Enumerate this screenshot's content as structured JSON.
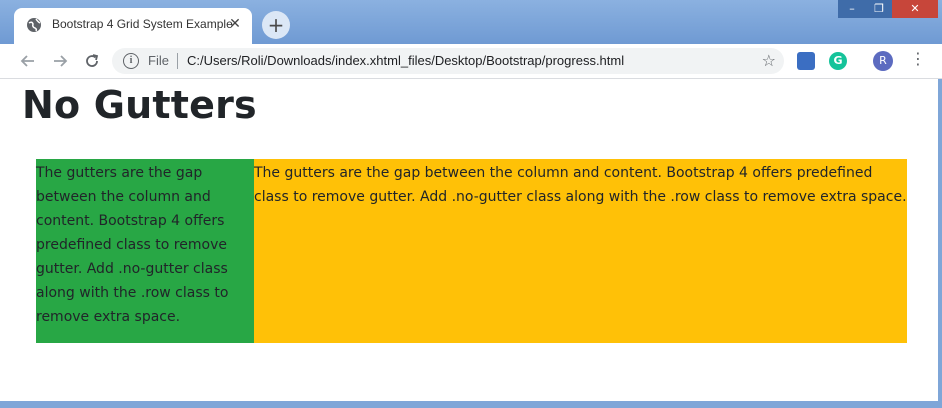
{
  "browser": {
    "tab_title": "Bootstrap 4 Grid System Example",
    "tab_close": "✕",
    "new_tab": "+",
    "url_scheme": "File",
    "url": "C:/Users/Roli/Downloads/index.xhtml_files/Desktop/Bootstrap/progress.html",
    "avatar_initial": "R",
    "extension_letter": "G",
    "window_controls": {
      "minimize": "–",
      "maximize": "❐",
      "close": "✕"
    }
  },
  "page": {
    "heading": "No Gutters",
    "columns": [
      {
        "text": "The gutters are the gap between the column and content. Bootstrap 4 offers predefined class to remove gutter. Add .no-gutter class along with the .row class to remove extra space.",
        "background": "#28a745"
      },
      {
        "text": "The gutters are the gap between the column and content. Bootstrap 4 offers predefined class to remove gutter. Add .no-gutter class along with the .row class to remove extra space.",
        "background": "#ffc107"
      }
    ]
  },
  "icons": {
    "back": "arrow-left-icon",
    "forward": "arrow-right-icon",
    "reload": "reload-icon",
    "info": "info-icon",
    "star": "star-icon",
    "menu": "more-vert-icon"
  }
}
